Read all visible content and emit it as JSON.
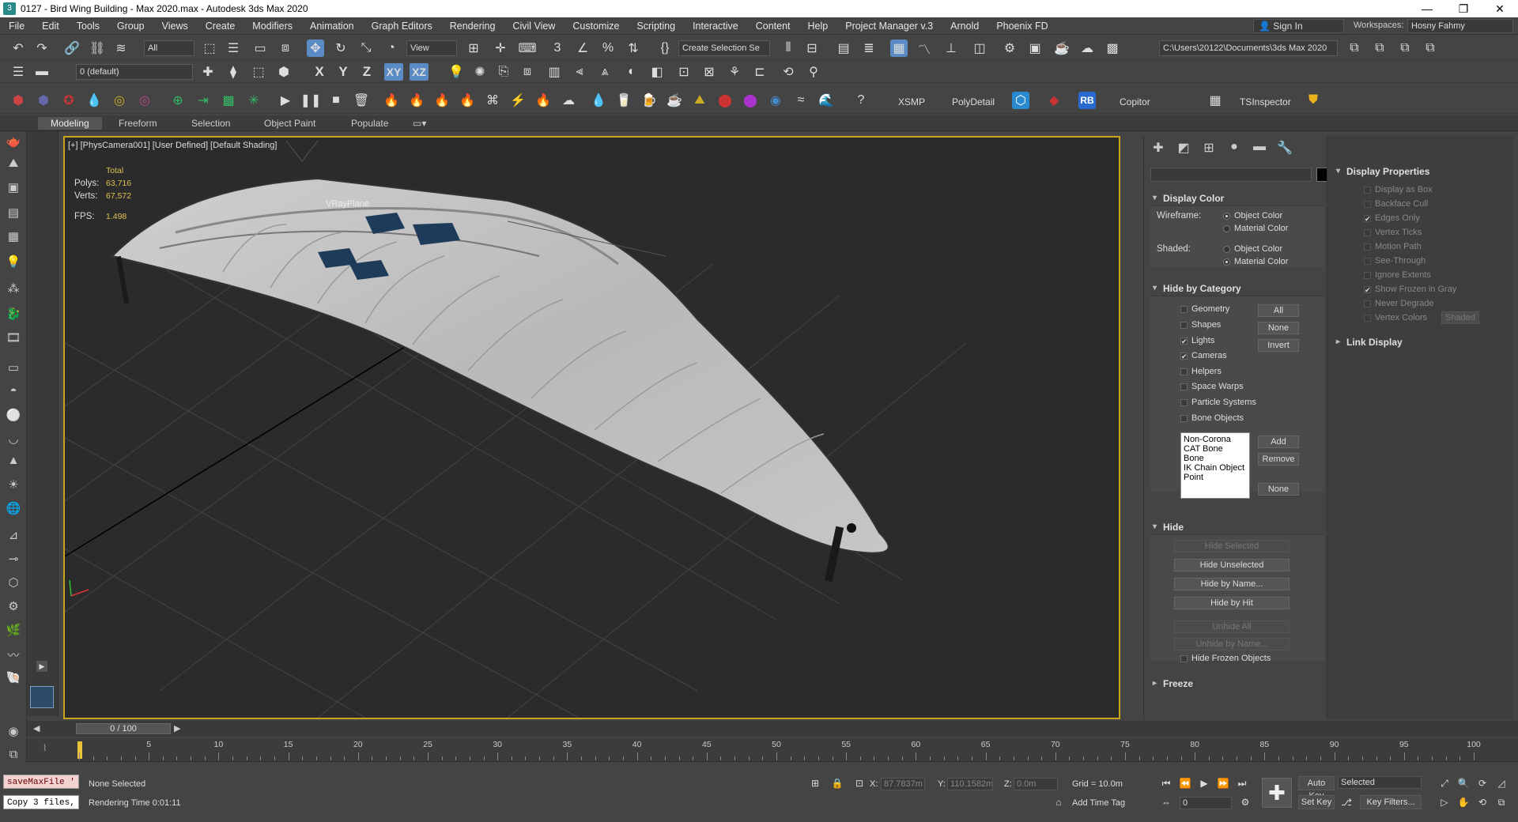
{
  "window": {
    "title": "0127 - Bird Wing Building - Max 2020.max - Autodesk 3ds Max 2020",
    "minimize": "—",
    "maximize": "❐",
    "close": "✕"
  },
  "menu": {
    "items": [
      "File",
      "Edit",
      "Tools",
      "Group",
      "Views",
      "Create",
      "Modifiers",
      "Animation",
      "Graph Editors",
      "Rendering",
      "Civil View",
      "Customize",
      "Scripting",
      "Interactive",
      "Content",
      "Help",
      "Project Manager v.3",
      "Arnold",
      "Phoenix FD"
    ],
    "sign_in": "Sign In",
    "workspaces_label": "Workspaces:",
    "workspace_value": "Hosny Fahmy"
  },
  "toolbar": {
    "filter_value": "All",
    "refcoord_value": "View",
    "selection_set_placeholder": "Create Selection Se",
    "project_path": "C:\\Users\\20122\\Documents\\3ds Max 2020",
    "layer_value": "0 (default)",
    "axis_x": "X",
    "axis_y": "Y",
    "axis_z": "Z",
    "axis_xy": "XY",
    "axis_xz": "XZ",
    "plugin_xsmp": "XSMP",
    "plugin_polydetail": "PolyDetail",
    "plugin_rb": "RB",
    "plugin_copitor": "Copitor",
    "plugin_tsinspector": "TSInspector"
  },
  "ribbon": {
    "tabs": [
      "Modeling",
      "Freeform",
      "Selection",
      "Object Paint",
      "Populate"
    ]
  },
  "viewport": {
    "label": "[+] [PhysCamera001] [User Defined] [Default Shading]",
    "stats": {
      "header": "Total",
      "polys_label": "Polys:",
      "polys_value": "63,716",
      "verts_label": "Verts:",
      "verts_value": "67,572",
      "fps_label": "FPS:",
      "fps_value": "1.498"
    },
    "object_label": "VRayPlane"
  },
  "command_panel": {
    "display_color": {
      "title": "Display Color",
      "wireframe_label": "Wireframe:",
      "shaded_label": "Shaded:",
      "object_color": "Object Color",
      "material_color": "Material Color"
    },
    "hide_by_category": {
      "title": "Hide by Category",
      "items": [
        {
          "label": "Geometry",
          "checked": false
        },
        {
          "label": "Shapes",
          "checked": false
        },
        {
          "label": "Lights",
          "checked": true
        },
        {
          "label": "Cameras",
          "checked": true
        },
        {
          "label": "Helpers",
          "checked": false
        },
        {
          "label": "Space Warps",
          "checked": false
        },
        {
          "label": "Particle Systems",
          "checked": false
        },
        {
          "label": "Bone Objects",
          "checked": false
        }
      ],
      "btn_all": "All",
      "btn_none": "None",
      "btn_invert": "Invert",
      "list": [
        "Non-Corona",
        "CAT Bone",
        "Bone",
        "IK Chain Object",
        "Point"
      ],
      "btn_add": "Add",
      "btn_remove": "Remove",
      "btn_none2": "None"
    },
    "hide": {
      "title": "Hide",
      "hide_selected": "Hide Selected",
      "hide_unselected": "Hide Unselected",
      "hide_by_name": "Hide by Name...",
      "hide_by_hit": "Hide by Hit",
      "unhide_all": "Unhide All",
      "unhide_by_name": "Unhide by Name...",
      "hide_frozen": "Hide Frozen Objects"
    },
    "freeze": {
      "title": "Freeze"
    }
  },
  "display_properties": {
    "title": "Display Properties",
    "items": [
      {
        "label": "Display as Box",
        "checked": false
      },
      {
        "label": "Backface Cull",
        "checked": false
      },
      {
        "label": "Edges Only",
        "checked": true
      },
      {
        "label": "Vertex Ticks",
        "checked": false
      },
      {
        "label": "Motion Path",
        "checked": false
      },
      {
        "label": "See-Through",
        "checked": false
      },
      {
        "label": "Ignore Extents",
        "checked": false
      },
      {
        "label": "Show Frozen in Gray",
        "checked": true
      },
      {
        "label": "Never Degrade",
        "checked": false
      },
      {
        "label": "Vertex Colors",
        "checked": false
      }
    ],
    "shaded_btn": "Shaded",
    "link_display_title": "Link Display"
  },
  "timeline": {
    "slider_text": "0 / 100",
    "ticks": [
      "0",
      "5",
      "10",
      "15",
      "20",
      "25",
      "30",
      "35",
      "40",
      "45",
      "50",
      "55",
      "60",
      "65",
      "70",
      "75",
      "80",
      "85",
      "90",
      "95",
      "100"
    ]
  },
  "status": {
    "maxscript_line1": "saveMaxFile '",
    "maxscript_line2": "Copy 3 files,",
    "selection_text": "None Selected",
    "render_time": "Rendering Time  0:01:11",
    "x_label": "X:",
    "x_value": "87.7837m",
    "y_label": "Y:",
    "y_value": "110.1582m",
    "z_label": "Z:",
    "z_value": "0.0m",
    "grid": "Grid = 10.0m",
    "add_time_tag": "Add Time Tag",
    "auto_key": "Auto Key",
    "set_key": "Set Key",
    "selected_value": "Selected",
    "key_filters": "Key Filters...",
    "frame_value": "0"
  }
}
